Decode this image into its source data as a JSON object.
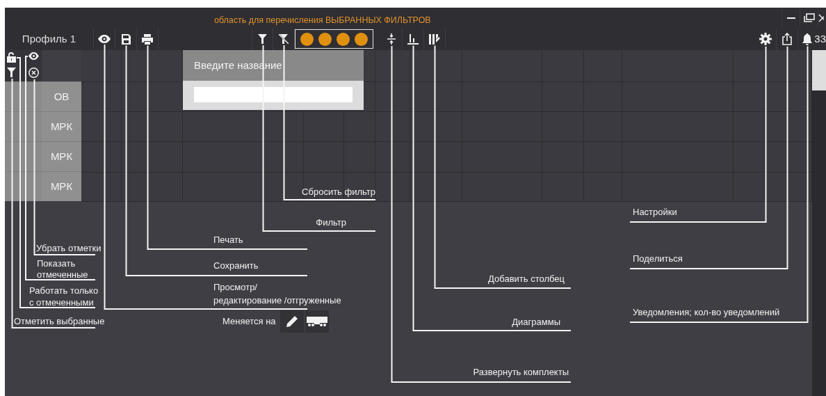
{
  "filters_area_label": "область для перечисления ВЫБРАННЫХ ФИЛЬТРОВ",
  "profile": "Профиль 1",
  "selected_filters": [
    {
      "color": "#e0900f"
    },
    {
      "color": "#e0900f"
    },
    {
      "color": "#e0900f"
    },
    {
      "color": "#e0900f"
    }
  ],
  "notification_count": "33",
  "rows": [
    {
      "label": "ОВ"
    },
    {
      "label": "МРК"
    },
    {
      "label": "МРК"
    },
    {
      "label": "МРК"
    }
  ],
  "name_popup": {
    "title": "Введите название"
  },
  "annotations": [
    {
      "text": "Сбросить фильтр"
    },
    {
      "text": "Фильтр"
    },
    {
      "text": "Печать"
    },
    {
      "text": "Сохранить"
    },
    {
      "text": "Просмотр/\nредактирование /отгруженные"
    },
    {
      "text": "Убрать отметки"
    },
    {
      "text": "Показать\nотмеченные"
    },
    {
      "text": "Работать только\nс отмеченными"
    },
    {
      "text": "Отметить выбранные"
    },
    {
      "text": "Добавить столбец"
    },
    {
      "text": "Диаграммы"
    },
    {
      "text": "Развернуть комплекты"
    },
    {
      "text": "Настройки"
    },
    {
      "text": "Поделиться"
    },
    {
      "text": "Уведомления; кол-во уведомлений"
    }
  ],
  "changes_to": "Меняется на"
}
